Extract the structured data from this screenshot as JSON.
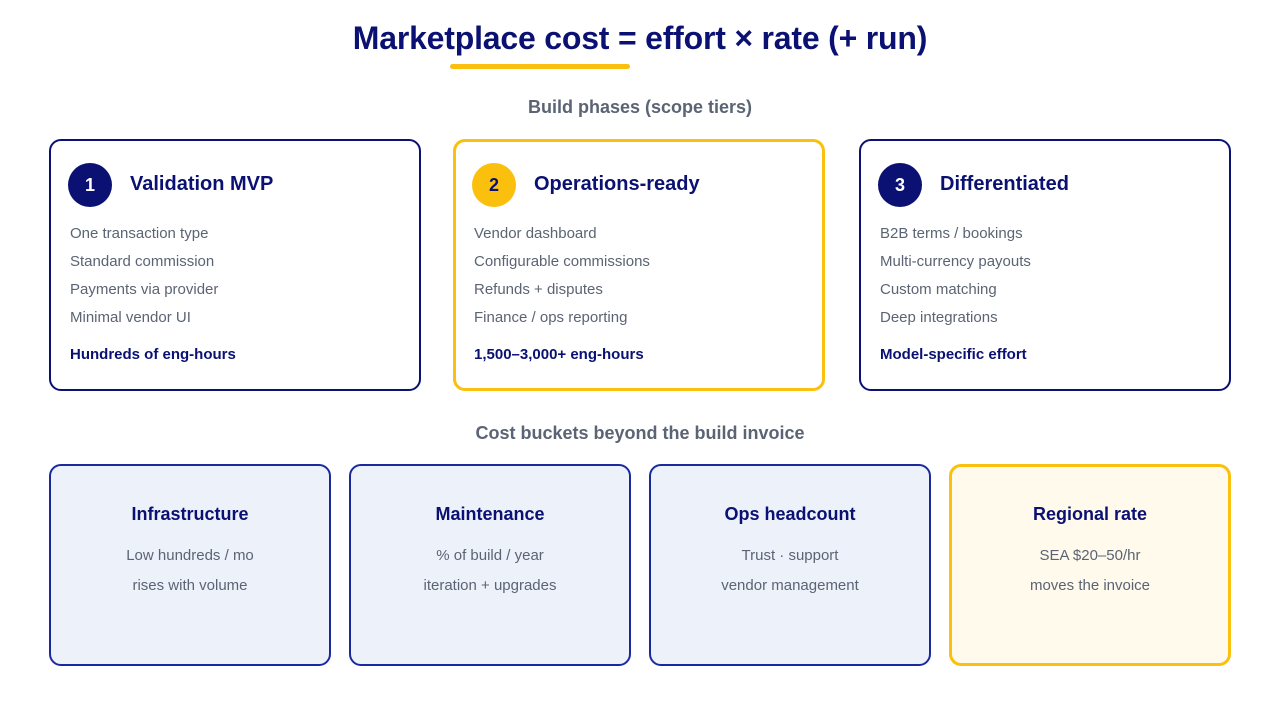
{
  "title": "Marketplace cost = effort × rate (+ run)",
  "phases_heading": "Build phases (scope tiers)",
  "phases": [
    {
      "number": "1",
      "title": "Validation MVP",
      "items": [
        "One transaction type",
        "Standard commission",
        "Payments via provider",
        "Minimal vendor UI"
      ],
      "effort": "Hundreds of eng-hours",
      "highlighted": false
    },
    {
      "number": "2",
      "title": "Operations-ready",
      "items": [
        "Vendor dashboard",
        "Configurable commissions",
        "Refunds + disputes",
        "Finance / ops reporting"
      ],
      "effort": "1,500–3,000+ eng-hours",
      "highlighted": true
    },
    {
      "number": "3",
      "title": "Differentiated",
      "items": [
        "B2B terms / bookings",
        "Multi-currency payouts",
        "Custom matching",
        "Deep integrations"
      ],
      "effort": "Model-specific effort",
      "highlighted": false
    }
  ],
  "buckets_heading": "Cost buckets beyond the build invoice",
  "buckets": [
    {
      "title": "Infrastructure",
      "line1": "Low hundreds / mo",
      "line2": "rises with volume",
      "highlighted": false
    },
    {
      "title": "Maintenance",
      "line1": "% of build / year",
      "line2": "iteration + upgrades",
      "highlighted": false
    },
    {
      "title": "Ops headcount",
      "line1": "Trust · support",
      "line2": "vendor management",
      "highlighted": false
    },
    {
      "title": "Regional rate",
      "line1": "SEA $20–50/hr",
      "line2": "moves the invoice",
      "highlighted": true
    }
  ],
  "colors": {
    "navy": "#0a1172",
    "accent": "#fbbf0e",
    "muted_text": "#5b6474",
    "bucket_fill": "#edf1fa",
    "bucket_fill_highlight": "#fffaec"
  }
}
